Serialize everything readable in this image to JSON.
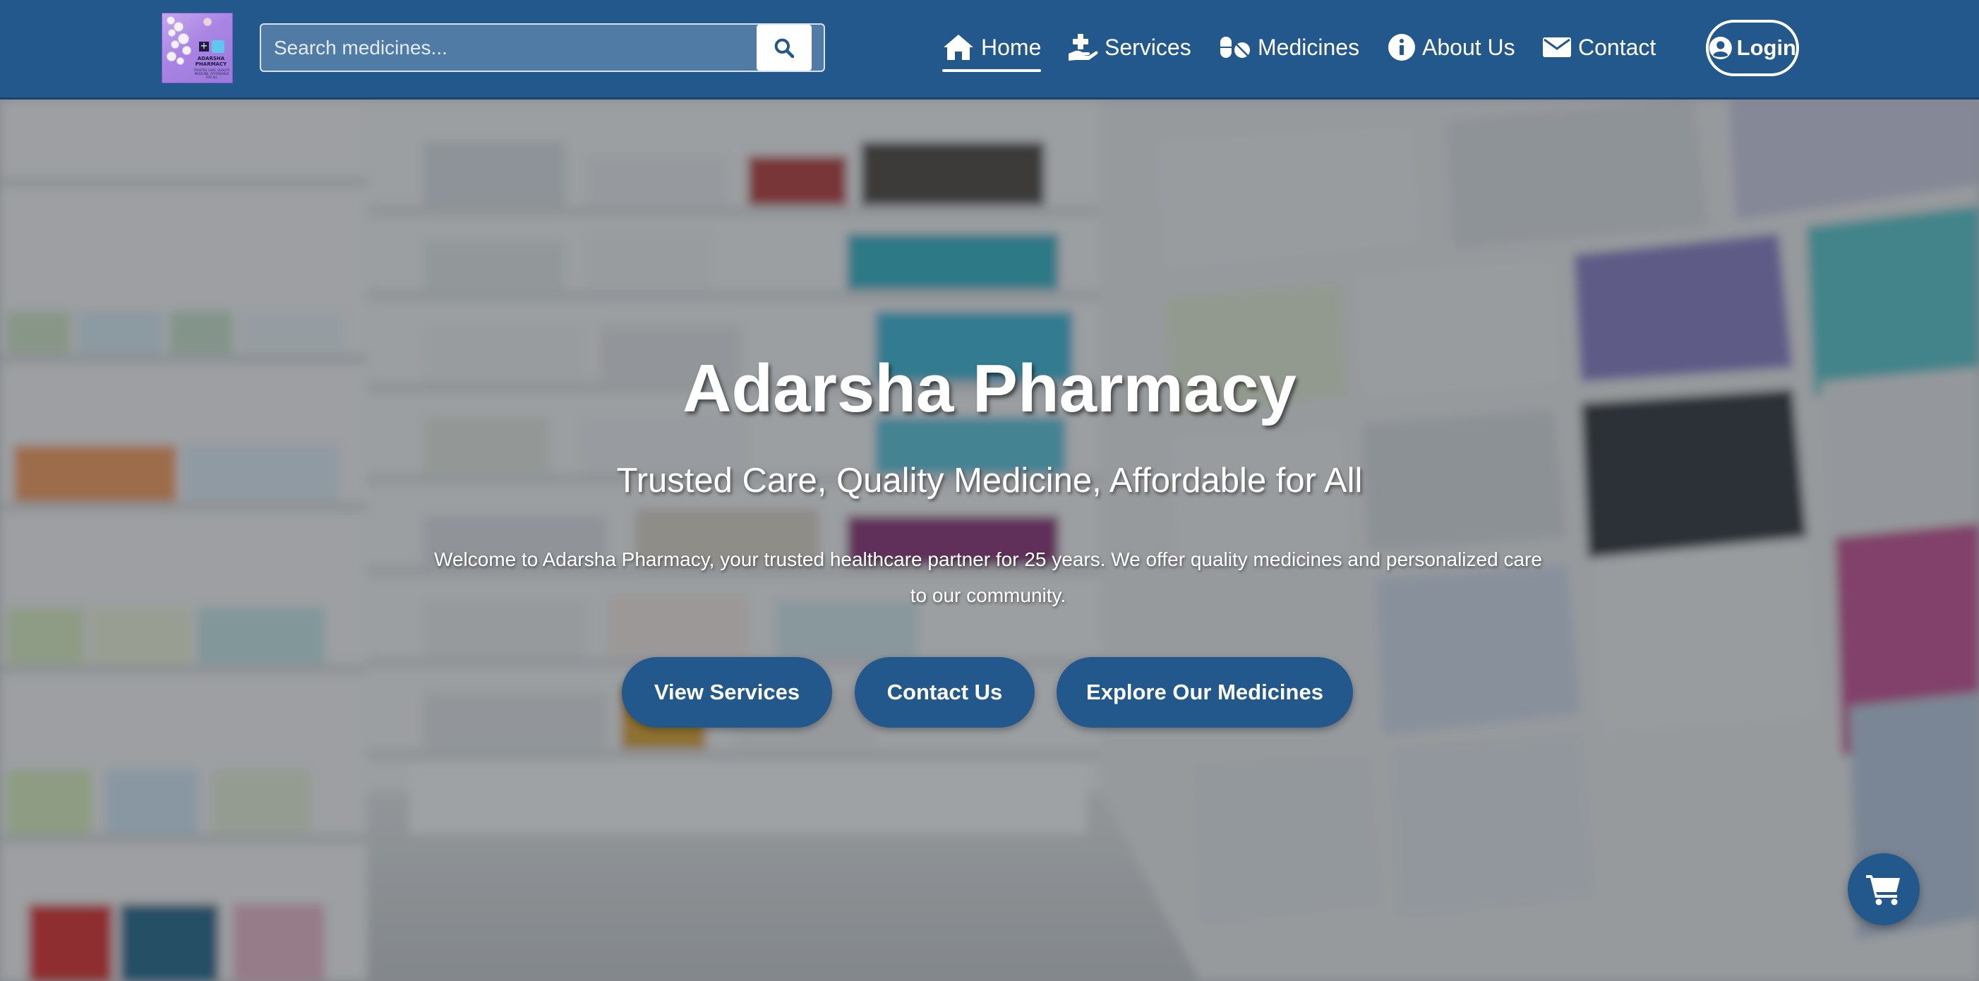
{
  "brand": {
    "logo_text": "ADARSHA PHARMACY",
    "logo_subtext": "TRUSTED CARE, QUALITY MEDICINE, AFFORDABLE FOR ALL"
  },
  "search": {
    "placeholder": "Search medicines...",
    "value": "",
    "button_icon": "search-icon"
  },
  "nav": {
    "items": [
      {
        "label": "Home",
        "icon": "home-icon",
        "active": true
      },
      {
        "label": "Services",
        "icon": "hand-medical-icon",
        "active": false
      },
      {
        "label": "Medicines",
        "icon": "pills-icon",
        "active": false
      },
      {
        "label": "About Us",
        "icon": "info-circle-icon",
        "active": false
      },
      {
        "label": "Contact",
        "icon": "envelope-icon",
        "active": false
      }
    ],
    "login_label": "Login",
    "login_icon": "user-circle-icon"
  },
  "hero": {
    "title": "Adarsha Pharmacy",
    "tagline": "Trusted Care, Quality Medicine, Affordable for All",
    "description": "Welcome to Adarsha Pharmacy, your trusted healthcare partner for 25 years. We offer quality medicines and personalized care to our community.",
    "buttons": [
      {
        "label": "View Services"
      },
      {
        "label": "Contact Us"
      },
      {
        "label": "Explore Our Medicines"
      }
    ],
    "background": "blurred-pharmacy-shelves-image"
  },
  "cart": {
    "icon": "shopping-cart-icon"
  },
  "colors": {
    "primary": "#23588d",
    "text_on_primary": "#ffffff"
  }
}
